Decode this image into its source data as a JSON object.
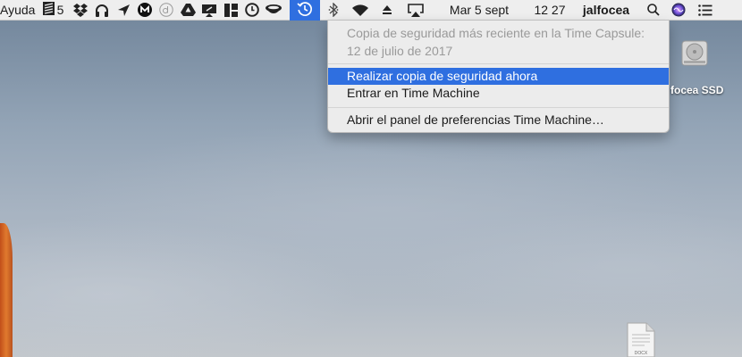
{
  "menubar": {
    "help_menu": "Ayuda",
    "counter_badge": "5",
    "date": "Mar 5 sept",
    "time": "12 27",
    "user": "jalfocea",
    "icons": [
      "stack-icon",
      "dropbox-icon",
      "headphones-icon",
      "location-arrow-icon",
      "m-app-icon",
      "d-app-icon",
      "drive-icon",
      "screen-share-icon",
      "grid-app-icon",
      "clock-app-icon",
      "coffee-icon",
      "time-machine-icon",
      "bluetooth-icon",
      "wifi-icon",
      "eject-icon",
      "airplay-icon",
      "spotlight-icon",
      "siri-icon",
      "notification-center-icon"
    ]
  },
  "time_machine_menu": {
    "status_line1": "Copia de seguridad más reciente en la Time Capsule:",
    "status_line2": "12 de julio de 2017",
    "backup_now": "Realizar copia de seguridad ahora",
    "enter_time_machine": "Entrar en Time Machine",
    "open_preferences": "Abrir el panel de preferencias Time Machine…"
  },
  "desktop": {
    "disk_label": "focea SSD",
    "doc_ext": "DOCX"
  },
  "colors": {
    "highlight": "#2f6fe0",
    "menubar_bg": "#eeeeee"
  }
}
